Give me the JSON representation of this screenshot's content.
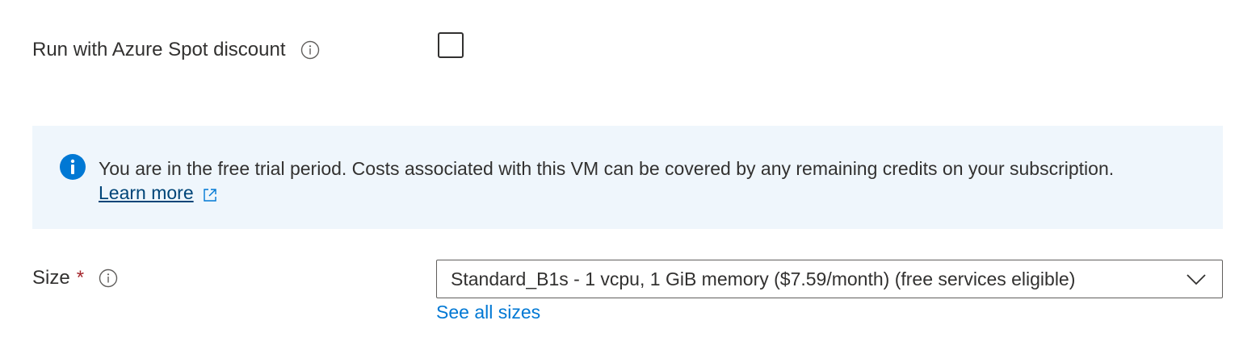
{
  "spot": {
    "label": "Run with Azure Spot discount",
    "checked": false
  },
  "banner": {
    "message": "You are in the free trial period. Costs associated with this VM can be covered by any remaining credits on your subscription.",
    "learn_more": "Learn more",
    "icon": "info-filled-icon"
  },
  "size": {
    "label": "Size",
    "required_marker": "*",
    "selected_value": "Standard_B1s - 1 vcpu, 1 GiB memory ($7.59/month)  (free services eligible)",
    "see_all_link": "See all sizes"
  },
  "colors": {
    "accent": "#0078d4",
    "banner_bg": "#eff6fc",
    "required": "#a4262c",
    "link_dark": "#004578"
  }
}
